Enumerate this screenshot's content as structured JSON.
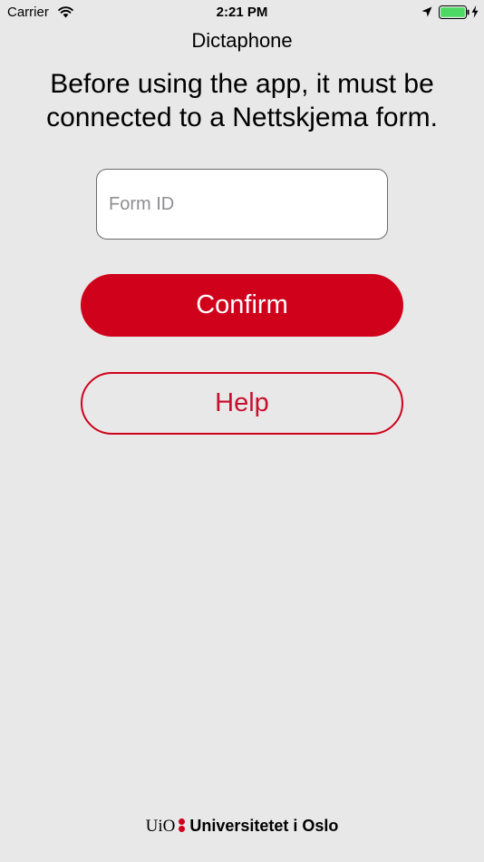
{
  "status_bar": {
    "carrier": "Carrier",
    "time": "2:21 PM",
    "battery_color": "#4cd964"
  },
  "nav": {
    "title": "Dictaphone"
  },
  "intro": {
    "text": "Before using the app, it must be connected to a Nettskjema form."
  },
  "form": {
    "form_id_placeholder": "Form ID",
    "form_id_value": "",
    "confirm_label": "Confirm",
    "help_label": "Help"
  },
  "footer": {
    "logo_mark": "UiO",
    "logo_name": "Universitetet i Oslo"
  },
  "colors": {
    "accent": "#d0021b",
    "background": "#e8e8e8"
  }
}
